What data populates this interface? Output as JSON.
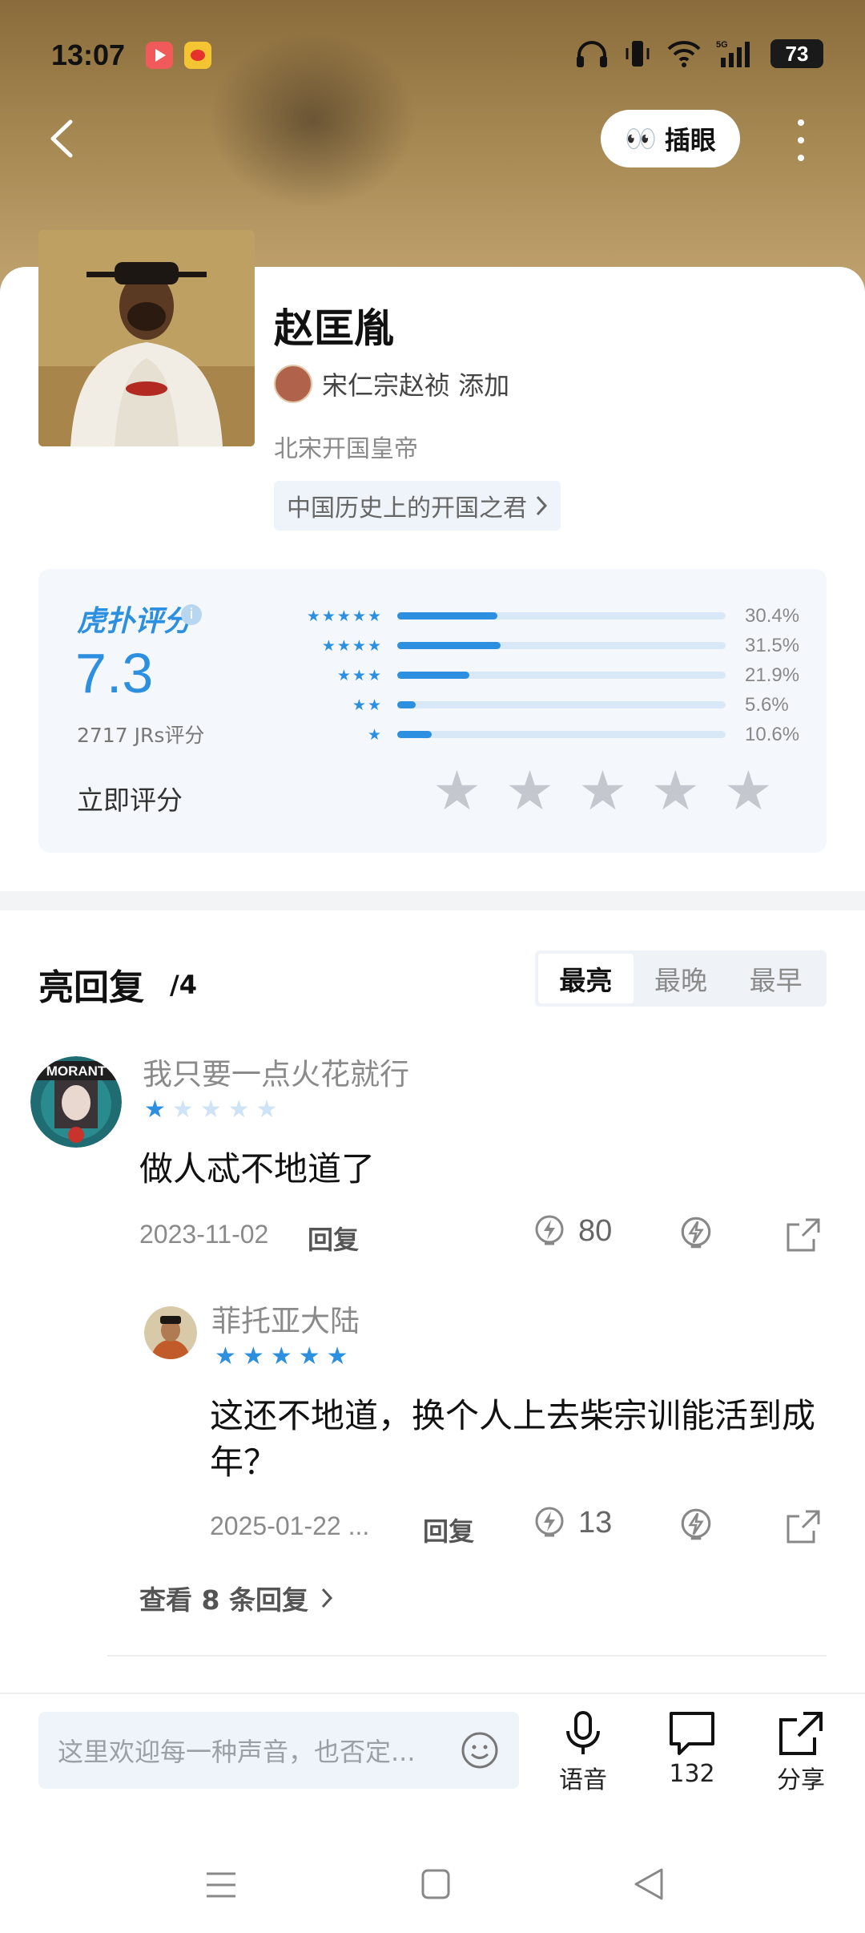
{
  "status_bar": {
    "time": "13:07",
    "battery": "73"
  },
  "header": {
    "peek_label": "插眼",
    "peek_emoji": "👀"
  },
  "profile": {
    "name": "赵匡胤",
    "added_by": "宋仁宗赵祯 添加",
    "subtitle": "北宋开国皇帝",
    "tag": "中国历史上的开国之君"
  },
  "rating": {
    "brand": "虎扑评分",
    "score": "7.3",
    "count_label": "2717 JRs评分",
    "rate_now": "立即评分",
    "distribution": [
      {
        "stars": "★★★★★",
        "percent": "30.4%",
        "value": 30.4
      },
      {
        "stars": "★★★★",
        "percent": "31.5%",
        "value": 31.5
      },
      {
        "stars": "★★★",
        "percent": "21.9%",
        "value": 21.9
      },
      {
        "stars": "★★",
        "percent": "5.6%",
        "value": 5.6
      },
      {
        "stars": "★",
        "percent": "10.6%",
        "value": 10.6
      }
    ]
  },
  "replies": {
    "title": "亮回复",
    "count": "/4",
    "sort_tabs": [
      "最亮",
      "最晚",
      "最早"
    ],
    "active_tab": "最亮",
    "main_comment": {
      "user": "我只要一点火花就行",
      "avatar_text": "MORANT",
      "stars": 1,
      "content": "做人忒不地道了",
      "date": "2023-11-02",
      "reply_label": "回复",
      "lights": "80"
    },
    "sub_comment": {
      "user": "菲托亚大陆",
      "stars": 5,
      "content": "这还不地道，换个人上去柴宗训能活到成年？",
      "date": "2025-01-22 ...",
      "reply_label": "回复",
      "lights": "13"
    },
    "view_more": "查看 8 条回复"
  },
  "bottom_bar": {
    "placeholder": "这里欢迎每一种声音，也否定...",
    "voice": "语音",
    "comments": "132",
    "share": "分享"
  }
}
